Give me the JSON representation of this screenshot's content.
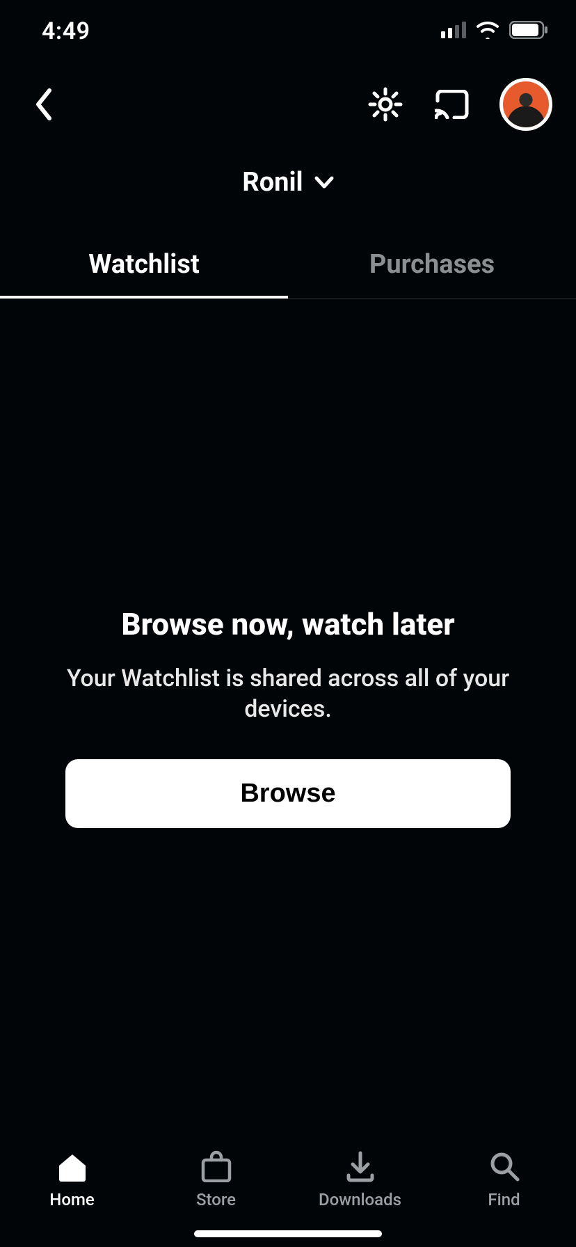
{
  "status": {
    "time": "4:49"
  },
  "profile": {
    "name": "Ronil"
  },
  "tabs": [
    {
      "label": "Watchlist",
      "active": true
    },
    {
      "label": "Purchases",
      "active": false
    }
  ],
  "empty": {
    "title": "Browse now, watch later",
    "subtitle": "Your Watchlist is shared across all of your devices.",
    "cta": "Browse"
  },
  "nav": [
    {
      "label": "Home",
      "active": true
    },
    {
      "label": "Store",
      "active": false
    },
    {
      "label": "Downloads",
      "active": false
    },
    {
      "label": "Find",
      "active": false
    }
  ]
}
